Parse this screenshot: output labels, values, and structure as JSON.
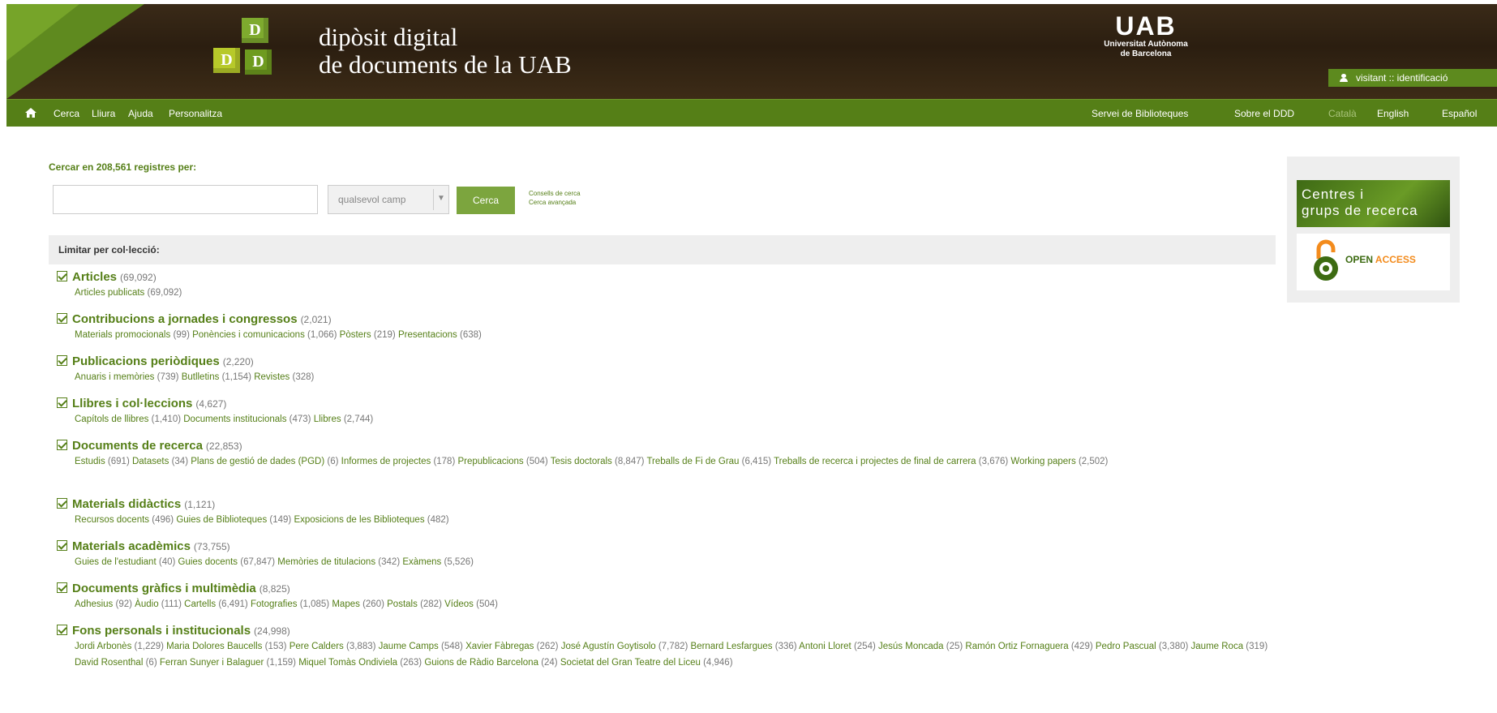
{
  "header": {
    "logo_letters": [
      "D",
      "D",
      "D"
    ],
    "title_line1": "dipòsit digital",
    "title_line2": "de documents de la UAB",
    "uab_logo": "UAB",
    "uab_name_line1": "Universitat Autònoma",
    "uab_name_line2": "de Barcelona",
    "user_text": "visitant :: identificació"
  },
  "nav": {
    "home_icon": "home-icon",
    "left": [
      "Cerca",
      "Lliura",
      "Ajuda",
      "Personalitza"
    ],
    "right": [
      "Servei de Biblioteques",
      "Sobre el DDD",
      "Català",
      "English",
      "Español"
    ]
  },
  "search": {
    "label": "Cercar en 208,561 registres per:",
    "input_value": "",
    "field_select": "qualsevol camp",
    "button": "Cerca",
    "link_tips": "Consells de cerca",
    "link_advanced": "Cerca avançada"
  },
  "collections": {
    "header": "Limitar per col·lecció:",
    "items": [
      {
        "title": "Articles",
        "count": "(69,092)",
        "subs": [
          [
            "Articles publicats",
            "(69,092)"
          ]
        ]
      },
      {
        "title": "Contribucions a jornades i congressos",
        "count": "(2,021)",
        "subs": [
          [
            "Materials promocionals",
            "(99)"
          ],
          [
            "Ponències i comunicacions",
            "(1,066)"
          ],
          [
            "Pòsters",
            "(219)"
          ],
          [
            "Presentacions",
            "(638)"
          ]
        ]
      },
      {
        "title": "Publicacions periòdiques",
        "count": "(2,220)",
        "subs": [
          [
            "Anuaris i memòries",
            "(739)"
          ],
          [
            "Butlletins",
            "(1,154)"
          ],
          [
            "Revistes",
            "(328)"
          ]
        ]
      },
      {
        "title": "Llibres i col·leccions",
        "count": "(4,627)",
        "subs": [
          [
            "Capítols de llibres",
            "(1,410)"
          ],
          [
            "Documents institucionals",
            "(473)"
          ],
          [
            "Llibres",
            "(2,744)"
          ]
        ]
      },
      {
        "title": "Documents de recerca",
        "count": "(22,853)",
        "subs": [
          [
            "Estudis",
            "(691)"
          ],
          [
            "Datasets",
            "(34)"
          ],
          [
            "Plans de gestió de dades (PGD)",
            "(6)"
          ],
          [
            "Informes de projectes",
            "(178)"
          ],
          [
            "Prepublicacions",
            "(504)"
          ],
          [
            "Tesis doctorals",
            "(8,847)"
          ],
          [
            "Treballs de Fi de Grau",
            "(6,415)"
          ],
          [
            "Treballs de recerca i projectes de final de carrera",
            "(3,676)"
          ],
          [
            "Working papers",
            "(2,502)"
          ]
        ]
      },
      {
        "title": "Materials didàctics",
        "count": "(1,121)",
        "subs": [
          [
            "Recursos docents",
            "(496)"
          ],
          [
            "Guies de Biblioteques",
            "(149)"
          ],
          [
            "Exposicions de les Biblioteques",
            "(482)"
          ]
        ]
      },
      {
        "title": "Materials acadèmics",
        "count": "(73,755)",
        "subs": [
          [
            "Guies de l'estudiant",
            "(40)"
          ],
          [
            "Guies docents",
            "(67,847)"
          ],
          [
            "Memòries de titulacions",
            "(342)"
          ],
          [
            "Exàmens",
            "(5,526)"
          ]
        ]
      },
      {
        "title": "Documents gràfics i multimèdia",
        "count": "(8,825)",
        "subs": [
          [
            "Adhesius",
            "(92)"
          ],
          [
            "Àudio",
            "(111)"
          ],
          [
            "Cartells",
            "(6,491)"
          ],
          [
            "Fotografies",
            "(1,085)"
          ],
          [
            "Mapes",
            "(260)"
          ],
          [
            "Postals",
            "(282)"
          ],
          [
            "Vídeos",
            "(504)"
          ]
        ]
      },
      {
        "title": "Fons personals i institucionals",
        "count": "(24,998)",
        "subs": [
          [
            "Jordi Arbonès",
            "(1,229)"
          ],
          [
            "Maria Dolores Baucells",
            "(153)"
          ],
          [
            "Pere Calders",
            "(3,883)"
          ],
          [
            "Jaume Camps",
            "(548)"
          ],
          [
            "Xavier Fàbregas",
            "(262)"
          ],
          [
            "José Agustín Goytisolo",
            "(7,782)"
          ],
          [
            "Bernard Lesfargues",
            "(336)"
          ],
          [
            "Antoni Lloret",
            "(254)"
          ],
          [
            "Jesús Moncada",
            "(25)"
          ],
          [
            "Ramón Ortiz Fornaguera",
            "(429)"
          ],
          [
            "Pedro Pascual",
            "(3,380)"
          ],
          [
            "Jaume Roca",
            "(319)"
          ],
          [
            "David Rosenthal",
            "(6)"
          ],
          [
            "Ferran Sunyer i Balaguer",
            "(1,159)"
          ],
          [
            "Miquel Tomàs Ondiviela ",
            "(263)"
          ],
          [
            "Guions de Ràdio Barcelona",
            "(24)"
          ],
          [
            "Societat del Gran Teatre del Liceu",
            "(4,946)"
          ]
        ]
      }
    ]
  },
  "sidebar": {
    "centres_line1": "Centres i",
    "centres_line2": "grups de recerca",
    "oa_open": "OPEN",
    "oa_access": "ACCESS"
  },
  "colors": {
    "brand_green": "#557f17",
    "header_brown": "#2b1e10",
    "oa_orange": "#f38b1c"
  }
}
